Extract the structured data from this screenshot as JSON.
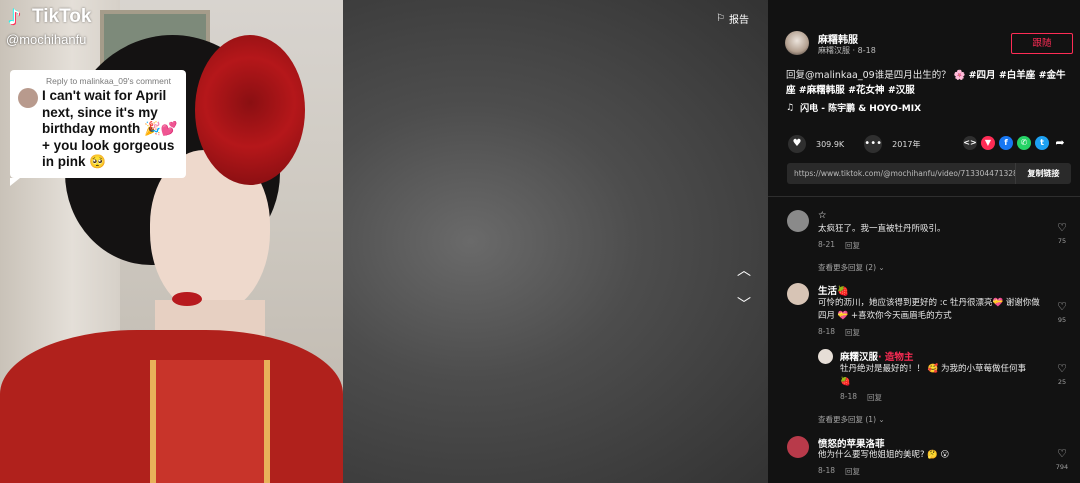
{
  "video": {
    "brand": "TikTok",
    "handle": "@mochihanfu",
    "reply_card": {
      "header": "Reply to malinkaa_09's comment",
      "text": "I can't wait for April next, since it's my birthday month 🎉💕 + you look gorgeous in pink 🥺"
    },
    "report_label": "报告"
  },
  "author": {
    "name": "麻糬韩服",
    "subtitle": "麻糬汉服 · 8-18",
    "follow_label": "跟随"
  },
  "description": {
    "text": "回复@malinkaa_09谁是四月出生的？ 🌸 ",
    "tags": "#四月 #白羊座 #金牛座 #麻糬韩服 #花女神 #汉服"
  },
  "music": {
    "icon": "music-note-icon",
    "text": "闪电 - 陈宇鹏 & HOYO-MIX"
  },
  "stats": {
    "likes": "309.9K",
    "comments": "2017年"
  },
  "share": {
    "icons": [
      "embed-icon",
      "repost-icon",
      "facebook-icon",
      "whatsapp-icon",
      "twitter-icon",
      "share-arrow-icon"
    ],
    "colors": [
      "#2f2f2f",
      "#fe2c55",
      "#1877f2",
      "#25d366",
      "#1da1f2",
      "#121212"
    ],
    "link": "https://www.tiktok.com/@mochihanfu/video/713304471328...",
    "copy_label": "复制链接"
  },
  "comments": [
    {
      "name": "☆",
      "text": "太疯狂了。我一直被牡丹所吸引。",
      "date": "8-21",
      "reply_label": "回复",
      "likes": "75",
      "more": "查看更多回复 (2)",
      "avatar_color": "#8a8a8a"
    },
    {
      "name": "生活🍓",
      "text": "可怜的沥川，她应该得到更好的 :c 牡丹很漂亮💝 谢谢你做四月 💝 +喜欢你今天画眉毛的方式",
      "date": "8-18",
      "reply_label": "回复",
      "likes": "95",
      "avatar_color": "#d7c4b5"
    },
    {
      "name": "麻糬汉服",
      "creator": "· 造物主",
      "text": "牡丹绝对是最好的！！ 🥰 为我的小草莓做任何事 🍓",
      "date": "8-18",
      "reply_label": "回复",
      "likes": "25",
      "more": "查看更多回复 (1)",
      "avatar_color": "#e6ded6"
    },
    {
      "name": "愤怒的苹果洛菲",
      "text": "他为什么要写他姐姐的美呢? 🤔 😮",
      "date": "8-18",
      "reply_label": "回复",
      "likes": "794",
      "avatar_color": "#b83a4a"
    }
  ]
}
